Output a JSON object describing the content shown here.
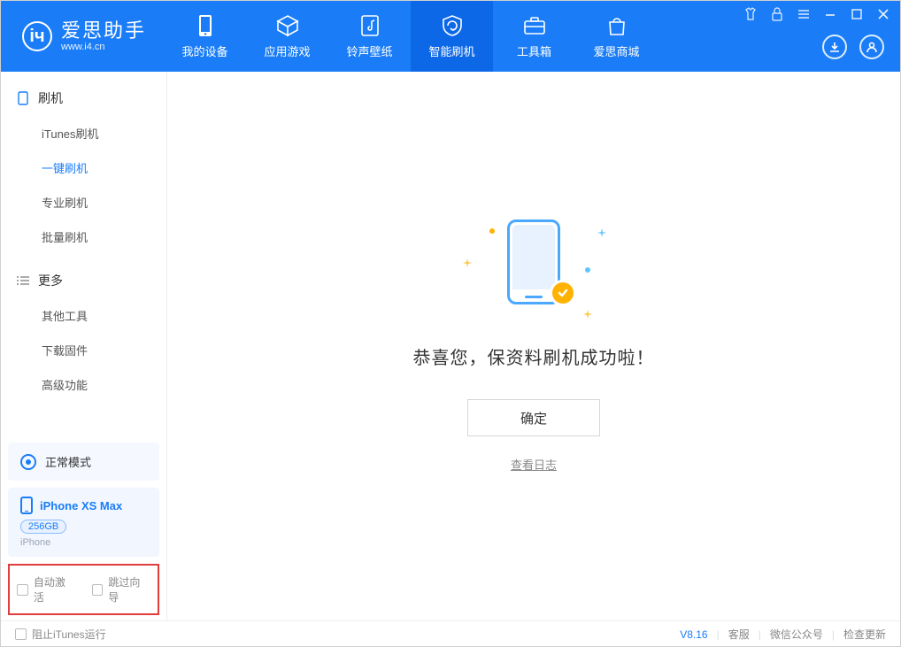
{
  "app": {
    "title": "爱思助手",
    "subtitle": "www.i4.cn"
  },
  "nav": {
    "tabs": [
      {
        "label": "我的设备"
      },
      {
        "label": "应用游戏"
      },
      {
        "label": "铃声壁纸"
      },
      {
        "label": "智能刷机"
      },
      {
        "label": "工具箱"
      },
      {
        "label": "爱思商城"
      }
    ],
    "active_index": 3
  },
  "sidebar": {
    "section1": {
      "title": "刷机",
      "items": [
        {
          "label": "iTunes刷机"
        },
        {
          "label": "一键刷机"
        },
        {
          "label": "专业刷机"
        },
        {
          "label": "批量刷机"
        }
      ],
      "active_index": 1
    },
    "section2": {
      "title": "更多",
      "items": [
        {
          "label": "其他工具"
        },
        {
          "label": "下载固件"
        },
        {
          "label": "高级功能"
        }
      ]
    },
    "mode": {
      "label": "正常模式"
    },
    "device": {
      "name": "iPhone XS Max",
      "capacity": "256GB",
      "type": "iPhone"
    },
    "checkboxes": {
      "auto_activate": "自动激活",
      "skip_guide": "跳过向导"
    }
  },
  "main": {
    "success_text": "恭喜您，保资料刷机成功啦！",
    "ok_button": "确定",
    "view_log": "查看日志"
  },
  "statusbar": {
    "block_itunes": "阻止iTunes运行",
    "version": "V8.16",
    "links": {
      "service": "客服",
      "wechat": "微信公众号",
      "update": "检查更新"
    }
  }
}
